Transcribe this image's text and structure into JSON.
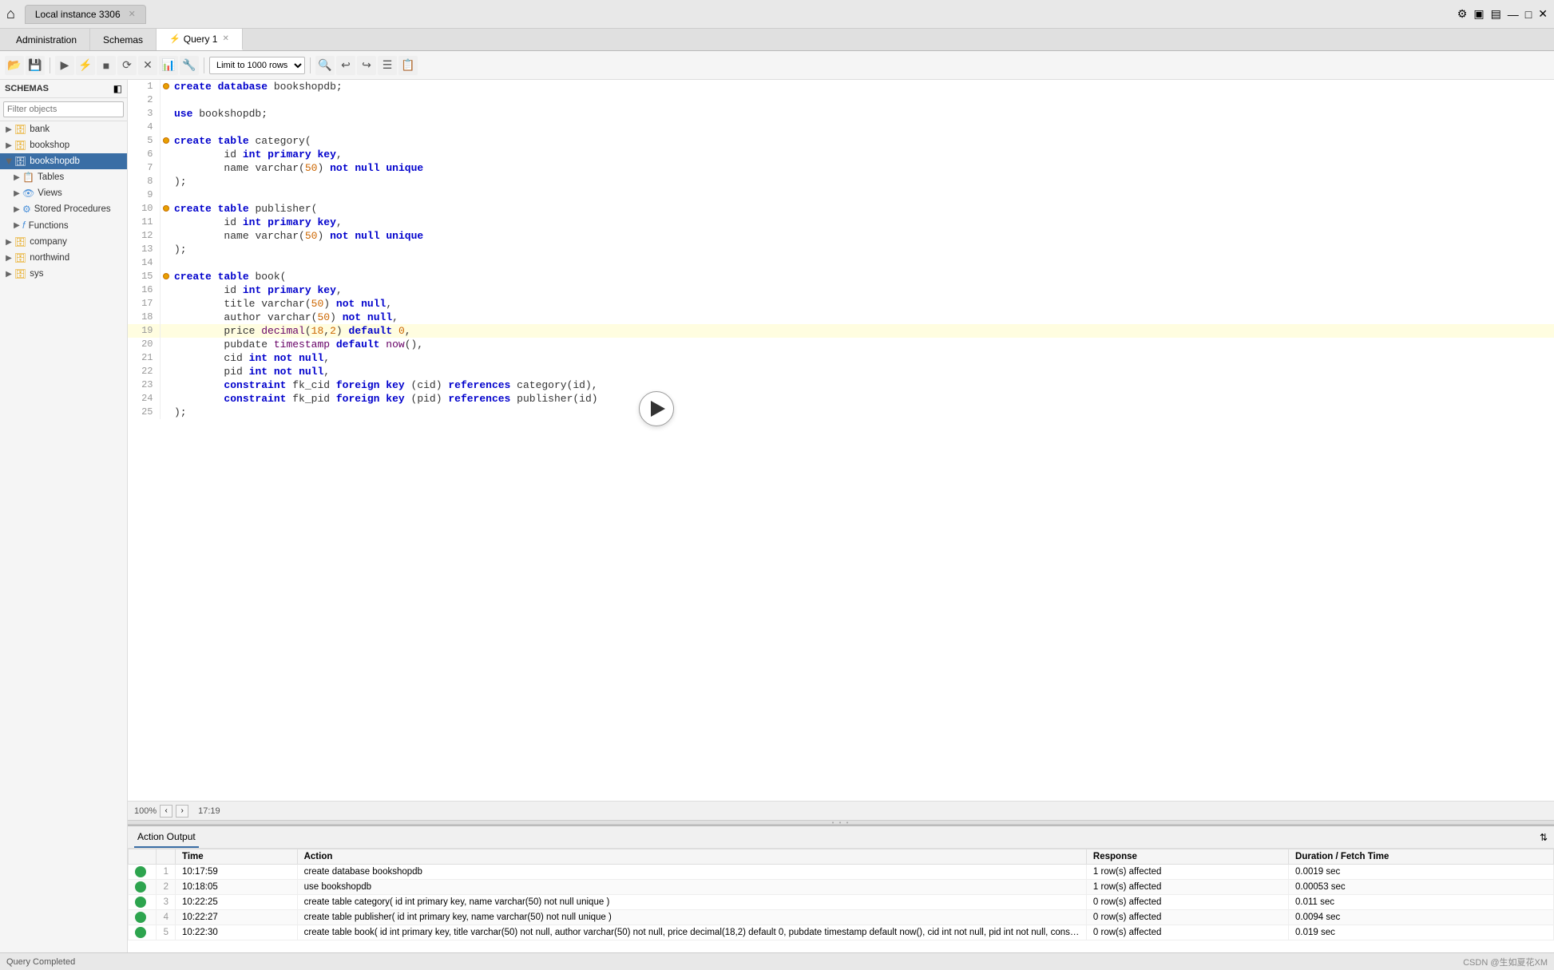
{
  "titlebar": {
    "instance_tab": "Local instance 3306",
    "home_icon": "🏠"
  },
  "navtabs": [
    {
      "label": "Administration",
      "active": false
    },
    {
      "label": "Schemas",
      "active": false
    },
    {
      "label": "Query 1",
      "active": true,
      "icon": "⚡"
    }
  ],
  "toolbar": {
    "limit_label": "Limit to 1000 rows",
    "buttons": [
      "📂",
      "💾",
      "✏️",
      "🔧",
      "▶️",
      "⏹",
      "⟳",
      "⬛",
      "🔍",
      "🔎",
      "⊕",
      "📋"
    ]
  },
  "sidebar": {
    "header": "SCHEMAS",
    "search_placeholder": "Filter objects",
    "items": [
      {
        "id": "bank",
        "label": "bank",
        "indent": 0,
        "has_arrow": true,
        "expanded": false,
        "icon": "🗄"
      },
      {
        "id": "bookshop",
        "label": "bookshop",
        "indent": 0,
        "has_arrow": true,
        "expanded": false,
        "icon": "🗄"
      },
      {
        "id": "bookshopdb",
        "label": "bookshopdb",
        "indent": 0,
        "has_arrow": true,
        "expanded": true,
        "icon": "🗄",
        "selected": true
      },
      {
        "id": "tables",
        "label": "Tables",
        "indent": 1,
        "has_arrow": true,
        "expanded": false,
        "icon": "📋"
      },
      {
        "id": "views",
        "label": "Views",
        "indent": 1,
        "has_arrow": true,
        "expanded": false,
        "icon": "👁"
      },
      {
        "id": "stored_procedures",
        "label": "Stored Procedures",
        "indent": 1,
        "has_arrow": true,
        "expanded": false,
        "icon": "⚙"
      },
      {
        "id": "functions",
        "label": "Functions",
        "indent": 1,
        "has_arrow": true,
        "expanded": false,
        "icon": "𝑓"
      },
      {
        "id": "company",
        "label": "company",
        "indent": 0,
        "has_arrow": true,
        "expanded": false,
        "icon": "🗄"
      },
      {
        "id": "northwind",
        "label": "northwind",
        "indent": 0,
        "has_arrow": true,
        "expanded": false,
        "icon": "🗄"
      },
      {
        "id": "sys",
        "label": "sys",
        "indent": 0,
        "has_arrow": true,
        "expanded": false,
        "icon": "🗄"
      }
    ]
  },
  "editor": {
    "lines": [
      {
        "num": 1,
        "marker": "dot",
        "code": "create database bookshopdb;"
      },
      {
        "num": 2,
        "marker": "",
        "code": ""
      },
      {
        "num": 3,
        "marker": "",
        "code": "use bookshopdb;"
      },
      {
        "num": 4,
        "marker": "",
        "code": ""
      },
      {
        "num": 5,
        "marker": "dot",
        "code": "create table category("
      },
      {
        "num": 6,
        "marker": "",
        "code": "    id int primary key,"
      },
      {
        "num": 7,
        "marker": "",
        "code": "    name varchar(50) not null unique"
      },
      {
        "num": 8,
        "marker": "",
        "code": ");"
      },
      {
        "num": 9,
        "marker": "",
        "code": ""
      },
      {
        "num": 10,
        "marker": "dot",
        "code": "create table publisher("
      },
      {
        "num": 11,
        "marker": "",
        "code": "    id int primary key,"
      },
      {
        "num": 12,
        "marker": "",
        "code": "    name varchar(50) not null unique"
      },
      {
        "num": 13,
        "marker": "",
        "code": ");"
      },
      {
        "num": 14,
        "marker": "",
        "code": ""
      },
      {
        "num": 15,
        "marker": "dot",
        "code": "create table book("
      },
      {
        "num": 16,
        "marker": "",
        "code": "    id int primary key,"
      },
      {
        "num": 17,
        "marker": "",
        "code": "    title varchar(50) not null,"
      },
      {
        "num": 18,
        "marker": "",
        "code": "    author varchar(50) not null,"
      },
      {
        "num": 19,
        "marker": "",
        "code": "    price decimal(18,2) default 0,",
        "highlighted": true
      },
      {
        "num": 20,
        "marker": "",
        "code": "    pubdate timestamp default now(),"
      },
      {
        "num": 21,
        "marker": "",
        "code": "    cid int not null,"
      },
      {
        "num": 22,
        "marker": "",
        "code": "    pid int not null,"
      },
      {
        "num": 23,
        "marker": "",
        "code": "    constraint fk_cid foreign key (cid) references category(id),"
      },
      {
        "num": 24,
        "marker": "",
        "code": "    constraint fk_pid foreign key (pid) references publisher(id)"
      },
      {
        "num": 25,
        "marker": "",
        "code": ");"
      }
    ]
  },
  "status_bar": {
    "zoom": "100%",
    "position": "17:19"
  },
  "bottom_panel": {
    "tabs": [
      "Action Output"
    ],
    "active_tab": "Action Output",
    "columns": [
      "",
      "Time",
      "Action",
      "Response",
      "Duration / Fetch Time"
    ],
    "rows": [
      {
        "num": 1,
        "time": "10:17:59",
        "action": "create database bookshopdb",
        "response": "1 row(s) affected",
        "duration": "0.0019 sec",
        "status": "green"
      },
      {
        "num": 2,
        "time": "10:18:05",
        "action": "use bookshopdb",
        "response": "1 row(s) affected",
        "duration": "0.00053 sec",
        "status": "green"
      },
      {
        "num": 3,
        "time": "10:22:25",
        "action": "create table category(  id int primary key,   name varchar(50) not null unique )",
        "response": "0 row(s) affected",
        "duration": "0.011 sec",
        "status": "green"
      },
      {
        "num": 4,
        "time": "10:22:27",
        "action": "create table publisher(  id int primary key,   name varchar(50) not null unique )",
        "response": "0 row(s) affected",
        "duration": "0.0094 sec",
        "status": "green"
      },
      {
        "num": 5,
        "time": "10:22:30",
        "action": "create table book(  id int primary key,   title varchar(50) not null,   author varchar(50) not null,   price decimal(18,2) default 0,   pubdate timestamp default now(),   cid int not null,   pid int not null,   constraint f...",
        "response": "0 row(s) affected",
        "duration": "0.019 sec",
        "status": "green"
      }
    ]
  },
  "app_status": {
    "message": "Query Completed",
    "branding": "CSDN @生如夏花XM"
  }
}
